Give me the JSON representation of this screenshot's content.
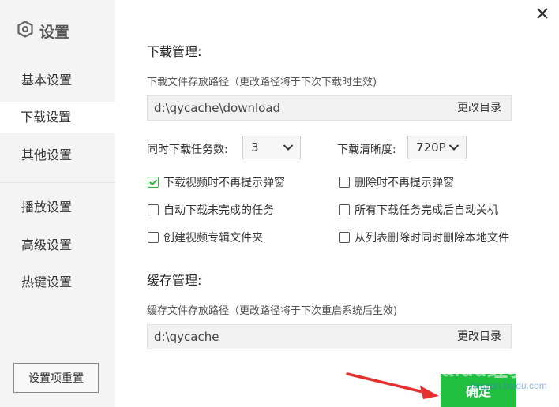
{
  "sidebar": {
    "title": "设置",
    "items": [
      {
        "label": "基本设置"
      },
      {
        "label": "下载设置"
      },
      {
        "label": "其他设置"
      },
      {
        "label": "播放设置"
      },
      {
        "label": "高级设置"
      },
      {
        "label": "热键设置"
      }
    ],
    "active_index": 1,
    "reset_label": "设置项重置"
  },
  "download": {
    "title": "下载管理:",
    "path_hint": "下载文件存放路径（更改路径将于下次下载时生效)",
    "path_value": "d:\\qycache\\download",
    "change_label": "更改目录",
    "tasks_label": "同时下载任务数:",
    "tasks_value": "3",
    "quality_label": "下载清晰度:",
    "quality_value": "720P",
    "options": [
      {
        "label": "下载视频时不再提示弹窗",
        "checked": true
      },
      {
        "label": "删除时不再提示弹窗",
        "checked": false
      },
      {
        "label": "自动下载未完成的任务",
        "checked": false
      },
      {
        "label": "所有下载任务完成后自动关机",
        "checked": false
      },
      {
        "label": "创建视频专辑文件夹",
        "checked": false
      },
      {
        "label": "从列表删除时同时删除本地文件",
        "checked": false
      }
    ]
  },
  "cache": {
    "title": "缓存管理:",
    "path_hint": "缓存文件存放路径（更改路径将于下次重启系统后生效)",
    "path_value": "d:\\qycache",
    "change_label": "更改目录"
  },
  "footer": {
    "confirm_label": "确定"
  },
  "watermark": {
    "text": "Baidu经验",
    "sub": "jingyan.baidu.com"
  },
  "colors": {
    "accent": "#20bf40",
    "sidebar_bg": "#f4f4f4",
    "arrow": "#e53030"
  }
}
